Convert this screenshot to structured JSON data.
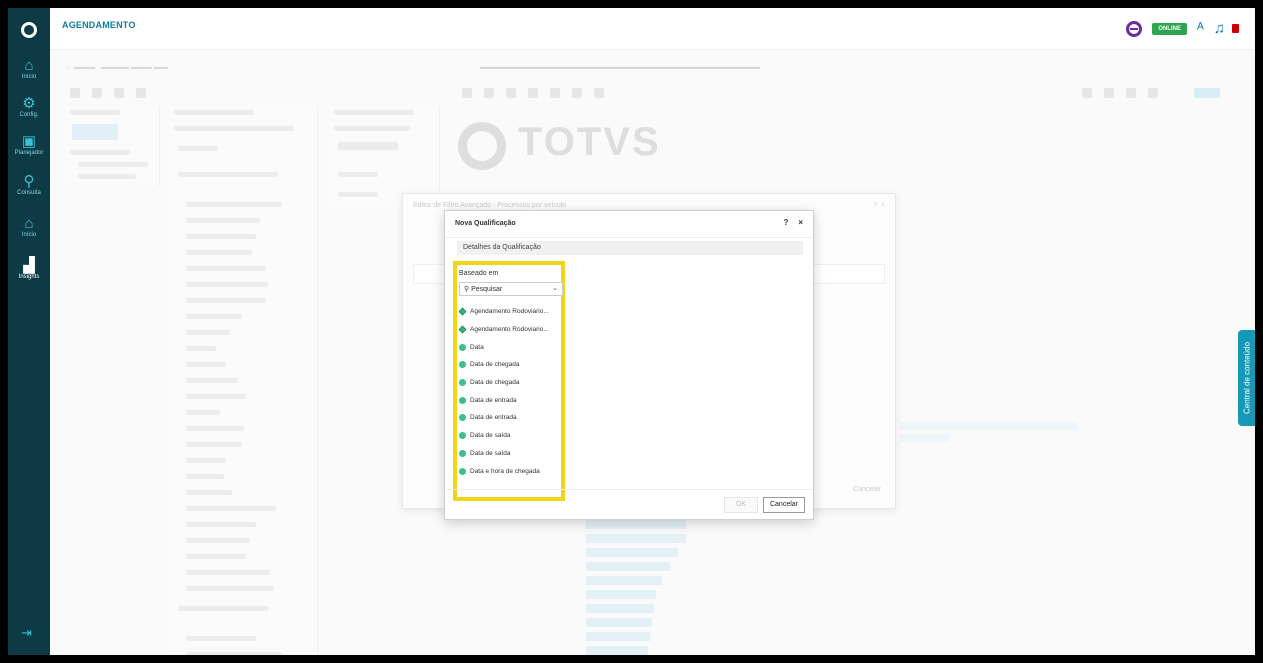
{
  "app": {
    "title": "AGENDAMENTO"
  },
  "header": {
    "status": "ONLINE"
  },
  "nav": {
    "items": [
      {
        "label": "Início",
        "icon": "home-icon"
      },
      {
        "label": "Config.",
        "icon": "gear-icon"
      },
      {
        "label": "Planejador",
        "icon": "calendar-icon"
      },
      {
        "label": "Consulta",
        "icon": "search-icon"
      },
      {
        "label": "Início",
        "icon": "home-icon"
      },
      {
        "label": "Insights",
        "icon": "chart-icon"
      }
    ]
  },
  "background": {
    "brand": "TOTVS"
  },
  "side_tab": {
    "label": "Central de conteúdo"
  },
  "outer_dialog": {
    "title": "Editor de Filtro Avançado - Processos por veículo",
    "cancel": "Cancelar"
  },
  "dialog": {
    "title": "Nova Qualificação",
    "help": "?",
    "close": "×",
    "section": "Detalhes da Qualificação",
    "based_on_label": "Baseado em",
    "search_placeholder": "Pesquisar",
    "items": [
      {
        "label": "Agendamento Rodoviario...",
        "kind": "diamond"
      },
      {
        "label": "Agendamento Rodoviario...",
        "kind": "diamond"
      },
      {
        "label": "Data",
        "kind": "round"
      },
      {
        "label": "Data de chegada",
        "kind": "round"
      },
      {
        "label": "Data de chegada",
        "kind": "round"
      },
      {
        "label": "Data de entrada",
        "kind": "round"
      },
      {
        "label": "Data de entrada",
        "kind": "round"
      },
      {
        "label": "Data de saída",
        "kind": "round"
      },
      {
        "label": "Data de saída",
        "kind": "round"
      },
      {
        "label": "Data e hora de chegada",
        "kind": "round"
      }
    ],
    "ok": "OK",
    "cancel": "Cancelar"
  },
  "colors": {
    "nav": "#0d3a44",
    "accent": "#1599b7",
    "highlight": "#f2d516",
    "online": "#2ea44f"
  }
}
